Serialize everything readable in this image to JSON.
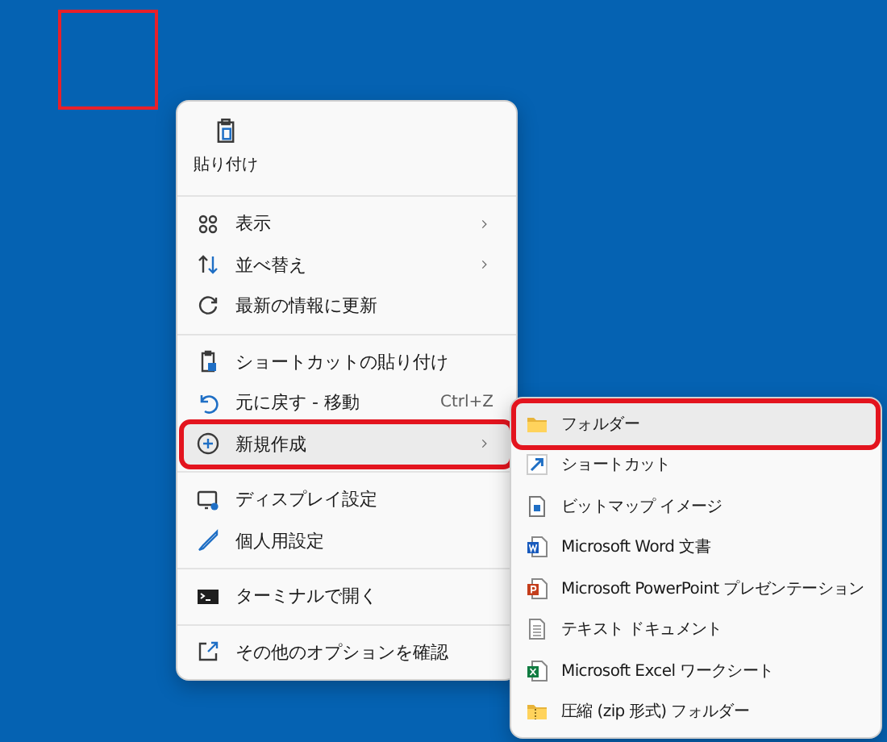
{
  "desktop": {
    "selection_frame": true
  },
  "context_menu": {
    "top_actions": [
      {
        "label": "貼り付け"
      }
    ],
    "sections": [
      {
        "items": [
          {
            "label": "表示",
            "submenu": true,
            "selected": false,
            "outlined": false
          },
          {
            "label": "並べ替え",
            "submenu": true,
            "selected": false,
            "outlined": false
          },
          {
            "label": "最新の情報に更新",
            "submenu": false,
            "selected": false,
            "outlined": false
          }
        ]
      },
      {
        "items": [
          {
            "label": "ショートカットの貼り付け",
            "submenu": false,
            "selected": false,
            "outlined": false
          },
          {
            "label": "元に戻す - 移動",
            "shortcut": "Ctrl+Z",
            "submenu": false,
            "selected": false,
            "outlined": false
          },
          {
            "label": "新規作成",
            "submenu": true,
            "selected": true,
            "outlined": true
          }
        ]
      },
      {
        "items": [
          {
            "label": "ディスプレイ設定",
            "submenu": false,
            "selected": false,
            "outlined": false
          },
          {
            "label": "個人用設定",
            "submenu": false,
            "selected": false,
            "outlined": false
          }
        ]
      },
      {
        "items": [
          {
            "label": "ターミナルで開く",
            "submenu": false,
            "selected": false,
            "outlined": false
          }
        ]
      },
      {
        "items": [
          {
            "label": "その他のオプションを確認",
            "submenu": false,
            "selected": false,
            "outlined": false
          }
        ]
      }
    ]
  },
  "new_submenu": {
    "items": [
      {
        "label": "フォルダー",
        "selected": true,
        "outlined": true
      },
      {
        "label": "ショートカット",
        "selected": false,
        "outlined": false
      },
      {
        "label": "ビットマップ イメージ",
        "selected": false,
        "outlined": false
      },
      {
        "label": "Microsoft Word 文書",
        "selected": false,
        "outlined": false
      },
      {
        "label": "Microsoft PowerPoint プレゼンテーション",
        "selected": false,
        "outlined": false
      },
      {
        "label": "テキスト ドキュメント",
        "selected": false,
        "outlined": false
      },
      {
        "label": "Microsoft Excel ワークシート",
        "selected": false,
        "outlined": false
      },
      {
        "label": "圧縮 (zip 形式) フォルダー",
        "selected": false,
        "outlined": false
      }
    ]
  }
}
